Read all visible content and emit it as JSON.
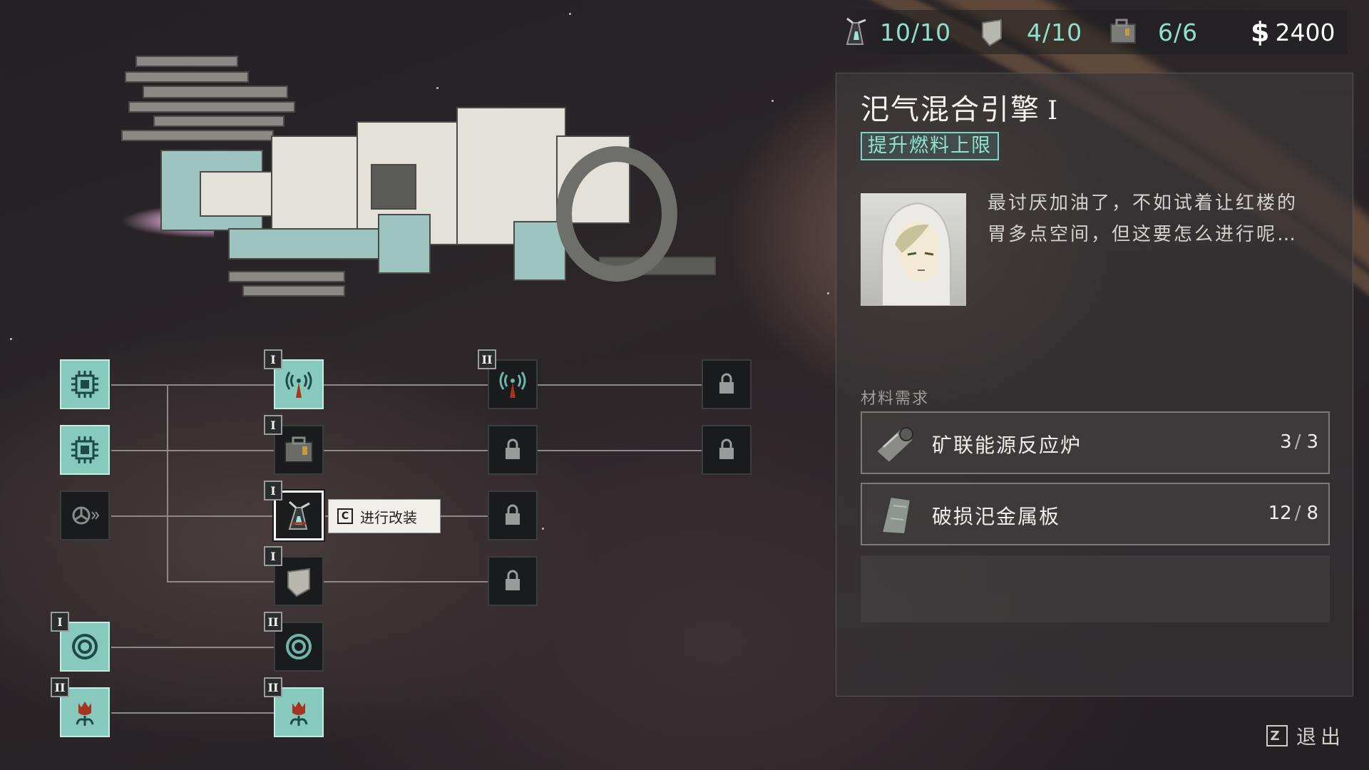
{
  "hud": {
    "fuel": "10/10",
    "armor": "4/10",
    "cargo": "6/6",
    "money_symbol": "$",
    "money": "2400",
    "accent_color": "#8fe0cf"
  },
  "tree": {
    "tiers": [
      "I",
      "I",
      "II",
      "I",
      "I",
      "I",
      "II",
      "I",
      "II"
    ],
    "tooltip_key": "C",
    "tooltip_label": "进行改装"
  },
  "panel": {
    "title": "汜气混合引擎",
    "title_tier": "I",
    "tag": "提升燃料上限",
    "quote_line1": "最讨厌加油了，不如试着让红楼的",
    "quote_line2": "胃多点空间，但这要怎么进行呢…",
    "materials_heading": "材料需求",
    "materials": [
      {
        "name": "矿联能源反应炉",
        "have": "3",
        "need": "3",
        "icon": "reactor-icon"
      },
      {
        "name": "破损汜金属板",
        "have": "12",
        "need": "8",
        "icon": "metal-plate-icon"
      }
    ]
  },
  "exit": {
    "key": "Z",
    "label": "退出"
  }
}
